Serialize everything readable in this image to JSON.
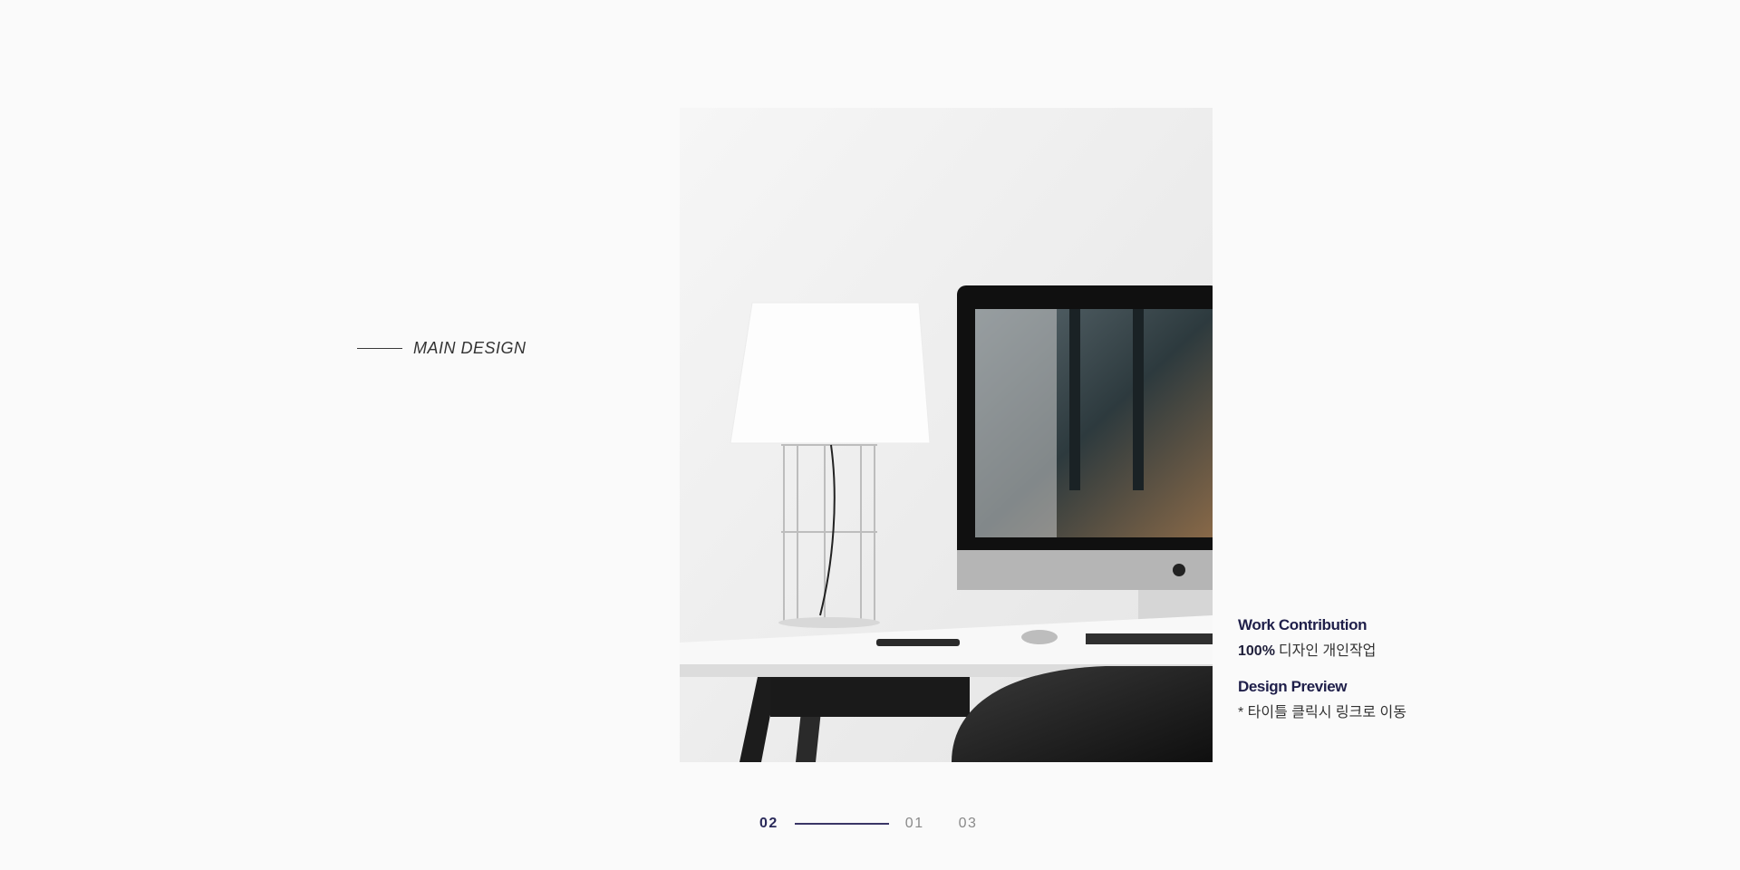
{
  "section": {
    "label": "MAIN DESIGN"
  },
  "preview": {
    "image_name": "desk-workspace-mockup"
  },
  "info": {
    "work_contribution_heading": "Work Contribution",
    "work_contribution_value": "100%",
    "work_contribution_text": "디자인 개인작업",
    "design_preview_heading": "Design Preview",
    "design_preview_text": "* 타이틀 클릭시 링크로 이동"
  },
  "pagination": {
    "current": "02",
    "pages": [
      "01",
      "03"
    ]
  },
  "colors": {
    "background": "#fafafa",
    "accent": "#2a2a5a",
    "muted": "#8a8a8a"
  }
}
